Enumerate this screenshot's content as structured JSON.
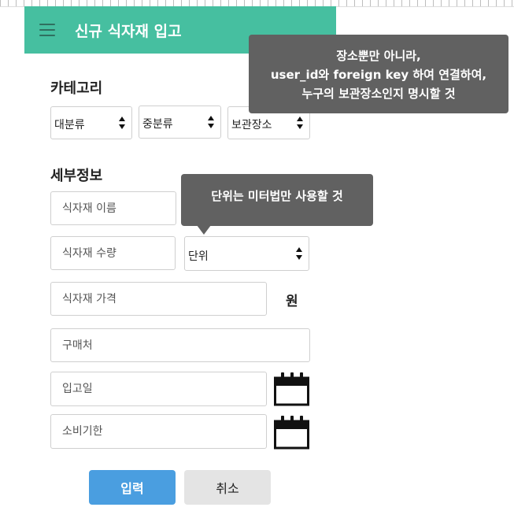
{
  "header": {
    "title": "신규 식자재 입고",
    "accent_color": "#46bfa0"
  },
  "category": {
    "title": "카테고리",
    "selects": [
      {
        "label": "대분류"
      },
      {
        "label": "중분류"
      },
      {
        "label": "보관장소"
      }
    ]
  },
  "details": {
    "title": "세부정보",
    "name_placeholder": "식자재 이름",
    "quantity_placeholder": "식자재 수량",
    "unit_label": "단위",
    "price_placeholder": "식자재 가격",
    "currency": "원",
    "vendor_placeholder": "구매처",
    "stock_date_placeholder": "입고일",
    "expiry_placeholder": "소비기한"
  },
  "icons": {
    "menu": "hamburger-icon",
    "calendar": "calendar-icon",
    "select_arrows": "up-down-arrows-icon"
  },
  "buttons": {
    "submit": "입력",
    "cancel": "취소",
    "submit_color": "#4a9ee0"
  },
  "tooltips": {
    "storage_note": [
      "장소뿐만 아니라,",
      "user_id와 foreign key 하여 연결하여,",
      "누구의 보관장소인지 명시할 것"
    ],
    "unit_note": "단위는 미터법만 사용할 것",
    "color": "#616161"
  }
}
